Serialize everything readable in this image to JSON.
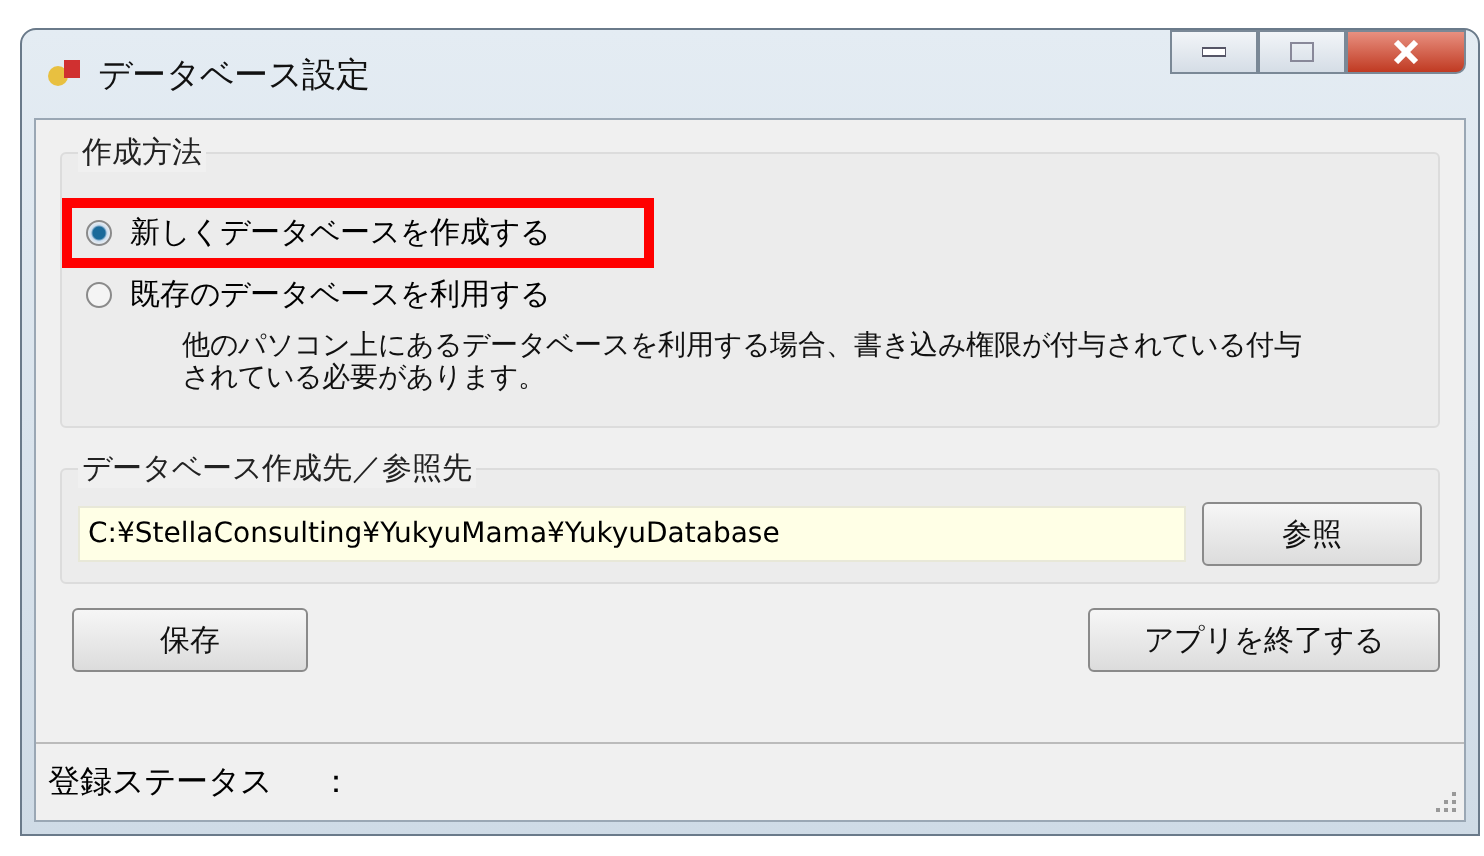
{
  "window": {
    "title": "データベース設定"
  },
  "creation_method": {
    "label": "作成方法",
    "options": [
      {
        "label": "新しくデータベースを作成する",
        "selected": true,
        "highlighted": true
      },
      {
        "label": "既存のデータベースを利用する",
        "selected": false,
        "highlighted": false
      }
    ],
    "note": "他のパソコン上にあるデータベースを利用する場合、書き込み権限が付与されている付与されている必要があります。"
  },
  "location": {
    "label": "データベース作成先／参照先",
    "value": "C:¥StellaConsulting¥YukyuMama¥YukyuDatabase",
    "browse_button": "参照"
  },
  "buttons": [
    {
      "kind": "save",
      "label": "保存"
    },
    {
      "kind": "exit",
      "label": "アプリを終了する"
    }
  ],
  "status_bar": {
    "label": "登録ステータス",
    "separator": "："
  }
}
